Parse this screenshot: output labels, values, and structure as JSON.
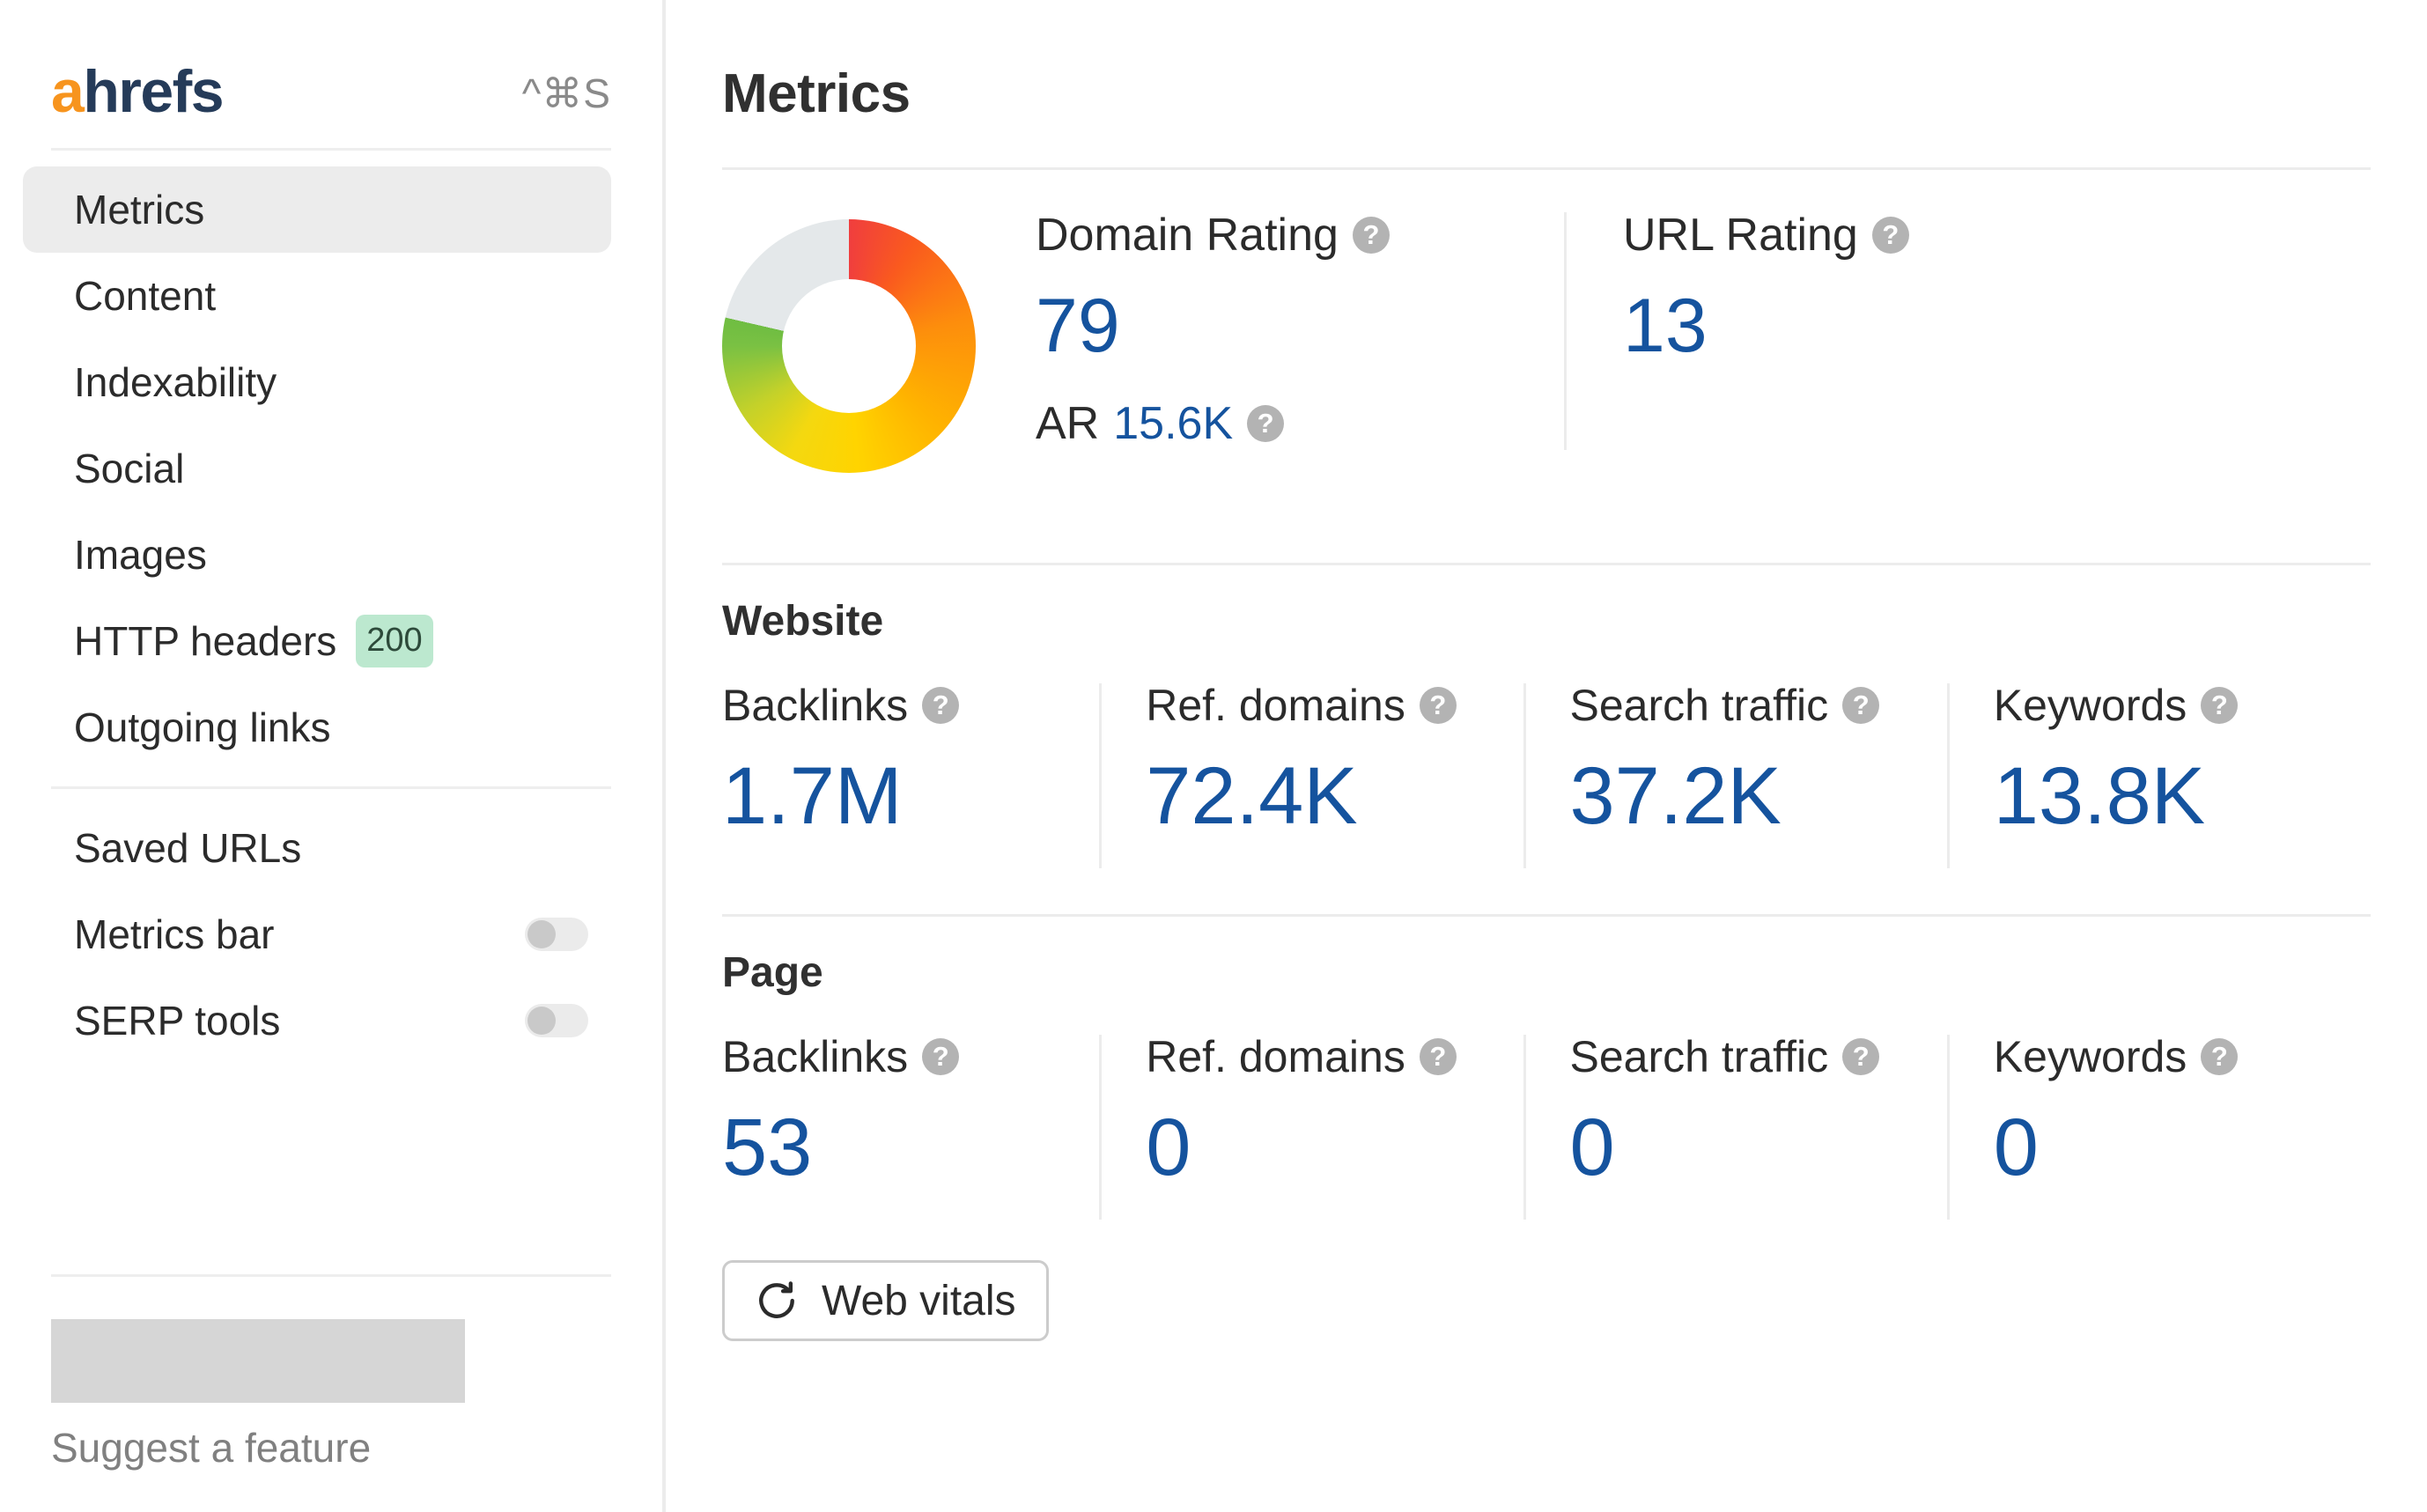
{
  "sidebar": {
    "logo": {
      "accent": "a",
      "rest": "hrefs",
      "accent_color": "#f7941e",
      "rest_color": "#253b59"
    },
    "shortcut": "^⌘S",
    "nav": [
      {
        "label": "Metrics",
        "active": true
      },
      {
        "label": "Content",
        "active": false
      },
      {
        "label": "Indexability",
        "active": false
      },
      {
        "label": "Social",
        "active": false
      },
      {
        "label": "Images",
        "active": false
      },
      {
        "label": "HTTP headers",
        "badge": "200",
        "badge_color": "#bce8cf",
        "active": false
      },
      {
        "label": "Outgoing links",
        "active": false
      }
    ],
    "settings": [
      {
        "label": "Saved URLs",
        "toggle": false
      },
      {
        "label": "Metrics bar",
        "toggle": true,
        "toggle_state": "off"
      },
      {
        "label": "SERP tools",
        "toggle": true,
        "toggle_state": "off"
      }
    ],
    "suggest_label": "Suggest a feature"
  },
  "main": {
    "title": "Metrics",
    "ratings": {
      "donut": {
        "filled_percent": 79,
        "empty_color": "#e4e8ea"
      },
      "domain_rating": {
        "label": "Domain Rating",
        "value": "79",
        "help": "help-icon"
      },
      "ar": {
        "label": "AR",
        "value": "15.6K",
        "help": "help-icon"
      },
      "url_rating": {
        "label": "URL Rating",
        "value": "13",
        "help": "help-icon"
      }
    },
    "website": {
      "title": "Website",
      "cells": [
        {
          "label": "Backlinks",
          "value": "1.7M"
        },
        {
          "label": "Ref. domains",
          "value": "72.4K"
        },
        {
          "label": "Search traffic",
          "value": "37.2K"
        },
        {
          "label": "Keywords",
          "value": "13.8K"
        }
      ]
    },
    "page": {
      "title": "Page",
      "cells": [
        {
          "label": "Backlinks",
          "value": "53"
        },
        {
          "label": "Ref. domains",
          "value": "0"
        },
        {
          "label": "Search traffic",
          "value": "0"
        },
        {
          "label": "Keywords",
          "value": "0"
        }
      ]
    },
    "web_vitals_button": {
      "label": "Web vitals",
      "icon": "refresh-icon"
    }
  },
  "colors": {
    "value_blue": "#15539e",
    "divider": "#ececec",
    "help_gray": "#b3b3b3"
  }
}
